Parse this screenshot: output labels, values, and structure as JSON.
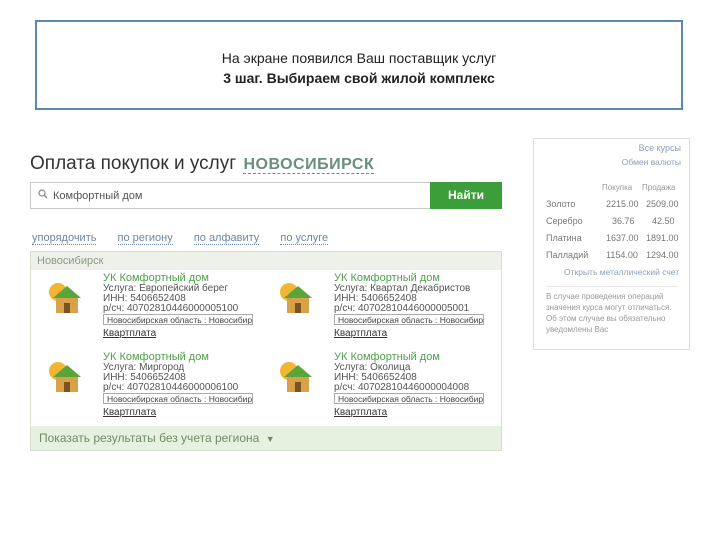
{
  "caption": {
    "line1": "На экране появился Ваш поставщик услуг",
    "line2": "3 шаг. Выбираем свой жилой комплекс"
  },
  "page": {
    "title": "Оплата покупок и услуг",
    "city": "НОВОСИБИРСК"
  },
  "search": {
    "value": "Комфортный дом",
    "button_label": "Найти"
  },
  "sort": [
    "упорядочить",
    "по региону",
    "по алфавиту",
    "по услуге"
  ],
  "results": {
    "region": "Новосибирск",
    "items": [
      {
        "name": "УК Комфортный дом",
        "service": "Услуга: Европейский берег",
        "inn": "ИНН: 5406652408",
        "account": "р/сч: 40702810446000005100",
        "region_select": "Новосибирская область : Новосибирск",
        "category": "Квартплата"
      },
      {
        "name": "УК Комфортный дом",
        "service": "Услуга: Квартал Декабристов",
        "inn": "ИНН: 5406652408",
        "account": "р/сч: 40702810446000005001",
        "region_select": "Новосибирская область : Новосибирск",
        "category": "Квартплата"
      },
      {
        "name": "УК Комфортный дом",
        "service": "Услуга: Миргород",
        "inn": "ИНН: 5406652408",
        "account": "р/сч: 40702810446000006100",
        "region_select": "Новосибирская область : Новосибирск",
        "category": "Квартплата"
      },
      {
        "name": "УК Комфортный дом",
        "service": "Услуга: Околица",
        "inn": "ИНН: 5406652408",
        "account": "р/сч: 40702810446000004008",
        "region_select": "Новосибирская область : Новосибирск",
        "category": "Квартплата"
      }
    ],
    "footer": "Показать результаты без учета региона"
  },
  "metals": {
    "top_link": "Все курсы",
    "exchange_link": "Обмен валюты",
    "headers": [
      "Покупка",
      "Продажа"
    ],
    "rows": [
      {
        "name": "Золото",
        "buy": "2215.00",
        "sell": "2509.00"
      },
      {
        "name": "Серебро",
        "buy": "36.76",
        "sell": "42.50"
      },
      {
        "name": "Платина",
        "buy": "1637.00",
        "sell": "1891.00"
      },
      {
        "name": "Палладий",
        "buy": "1154.00",
        "sell": "1294.00"
      }
    ],
    "open_account_link": "Открыть металлический счет",
    "note": "В случае проведения операций значения курса могут отличаться. Об этом случае вы обязательно уведомлены Вас"
  },
  "colors": {
    "caption_border": "#5b87b5",
    "accent_green": "#3c9e3a",
    "link_green": "#4ea04b",
    "city_color": "#6a8f7a"
  }
}
